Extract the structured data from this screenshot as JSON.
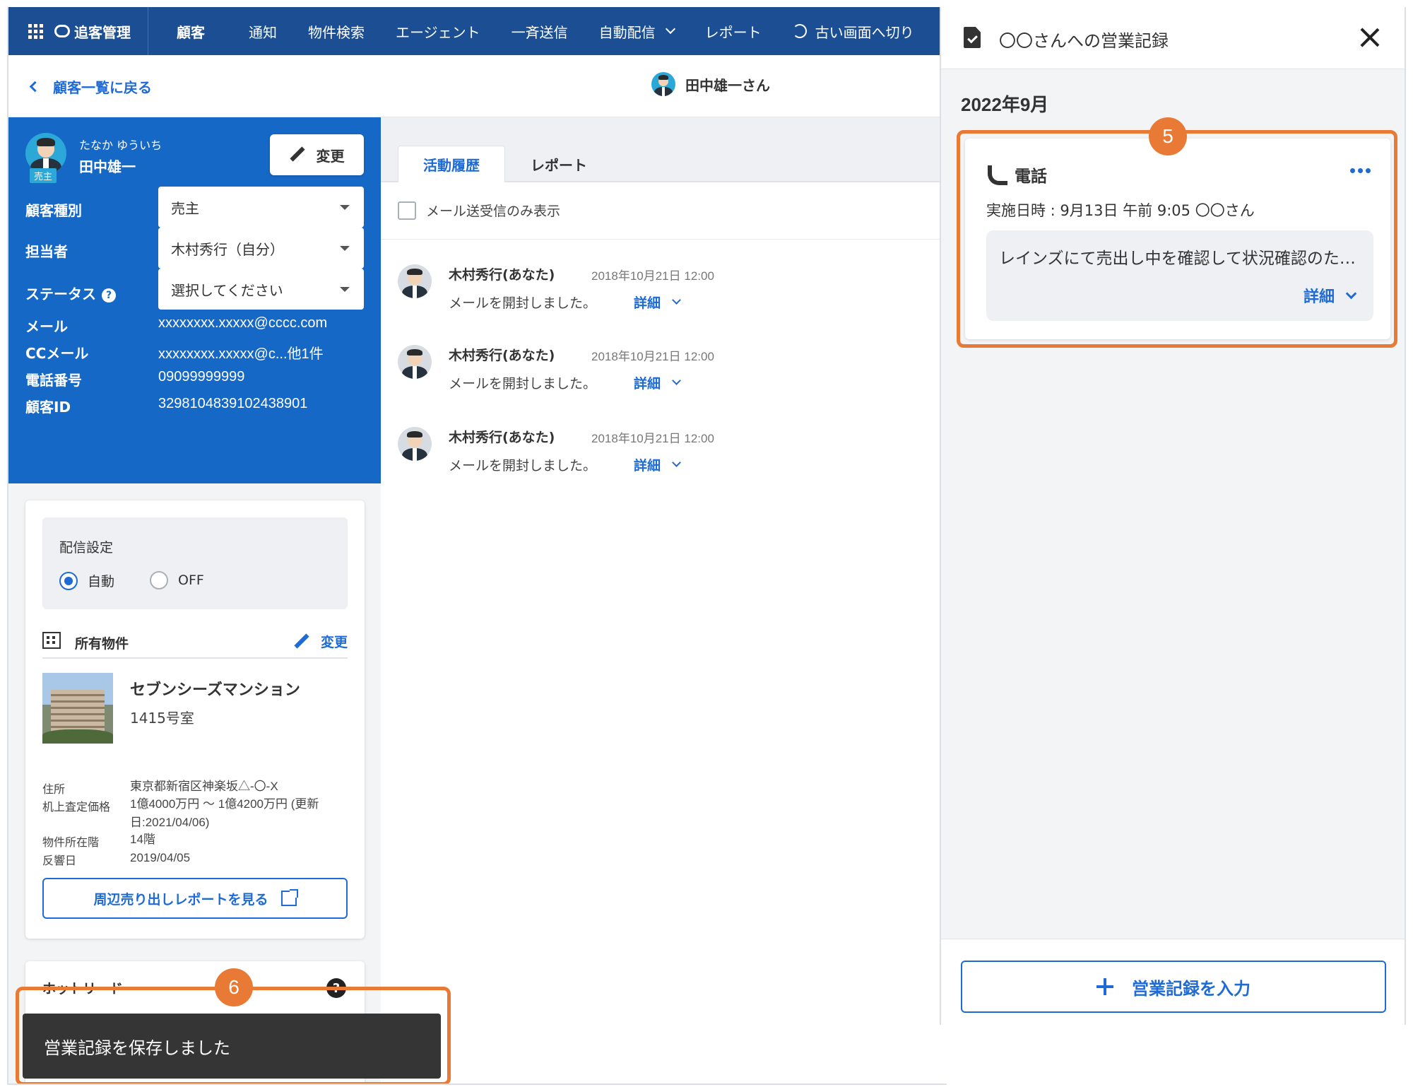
{
  "nav": {
    "brand": "追客管理",
    "items": [
      {
        "label": "顧客",
        "active": true
      },
      {
        "label": "通知"
      },
      {
        "label": "物件検索"
      },
      {
        "label": "エージェント"
      },
      {
        "label": "一斉送信"
      },
      {
        "label": "自動配信"
      },
      {
        "label": "レポート"
      },
      {
        "label": "古い画面へ切り"
      }
    ],
    "accent": "#1c4e94"
  },
  "subheader": {
    "back": "顧客一覧に戻る",
    "customer": "田中雄一さん"
  },
  "profile": {
    "kana": "たなか ゆういち",
    "name": "田中雄一",
    "badge": "売主",
    "change": "変更",
    "fields": [
      {
        "label": "顧客種別",
        "value": "売主"
      },
      {
        "label": "担当者",
        "value": "木村秀行（自分）"
      },
      {
        "label": "ステータス",
        "value": "選択してください"
      }
    ],
    "info": [
      {
        "label": "メール",
        "value": "xxxxxxxx.xxxxx@cccc.com"
      },
      {
        "label": "CCメール",
        "value": "xxxxxxxx.xxxxx@c...他1件"
      },
      {
        "label": "電話番号",
        "value": "09099999999"
      },
      {
        "label": "顧客ID",
        "value": "3298104839102438901"
      }
    ],
    "panel_color": "#1668c6"
  },
  "delivery": {
    "title": "配信設定",
    "options": [
      {
        "label": "自動",
        "selected": true
      },
      {
        "label": "OFF",
        "selected": false
      }
    ]
  },
  "property": {
    "section": "所有物件",
    "change": "変更",
    "name": "セブンシーズマンション",
    "room": "1415号室",
    "details": [
      {
        "key": "住所",
        "value": "東京都新宿区神楽坂△-〇-X"
      },
      {
        "key": "机上査定価格",
        "value": "1億4000万円 〜 1億4200万円 (更新日:2021/04/06)"
      },
      {
        "key": "物件所在階",
        "value": "14階"
      },
      {
        "key": "反響日",
        "value": "2019/04/05"
      }
    ],
    "report_button": "周辺売り出しレポートを見る"
  },
  "hotlead": {
    "title": "ホットリード"
  },
  "center": {
    "tabs": [
      "活動履歴",
      "レポート"
    ],
    "filter": "メール送受信のみ表示",
    "activities": [
      {
        "who": "木村秀行(あなた)",
        "time": "2018年10月21日 12:00",
        "desc": "メールを開封しました。",
        "detail": "詳細"
      },
      {
        "who": "木村秀行(あなた)",
        "time": "2018年10月21日 12:00",
        "desc": "メールを開封しました。",
        "detail": "詳細"
      },
      {
        "who": "木村秀行(あなた)",
        "time": "2018年10月21日 12:00",
        "desc": "メールを開封しました。",
        "detail": "詳細"
      }
    ]
  },
  "toast": {
    "message": "営業記録を保存しました",
    "step": "6"
  },
  "drawer": {
    "title": "〇〇さんへの営業記録",
    "month": "2022年9月",
    "step": "5",
    "record": {
      "type": "電話",
      "date": "実施日時 : 9月13日 午前 9:05 〇〇さん",
      "memo": "レインズにて売出し中を確認して状況確認のため連絡",
      "detail": "詳細"
    },
    "add_button": "営業記録を入力",
    "highlight_color": "#e87a35"
  }
}
